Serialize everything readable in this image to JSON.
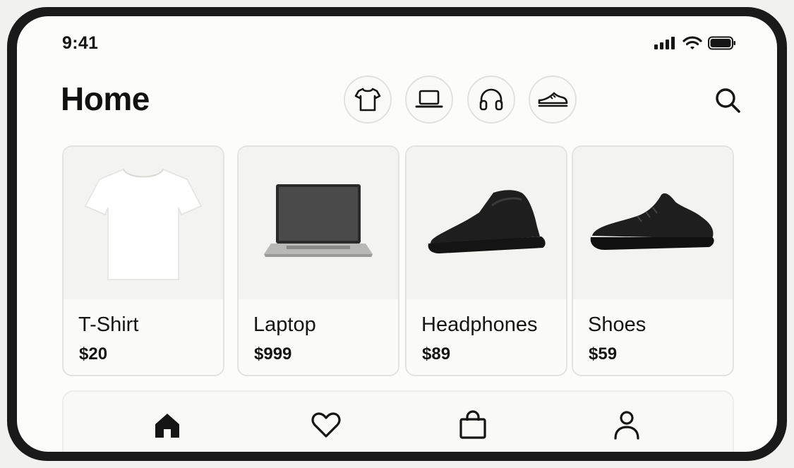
{
  "status_bar": {
    "time": "9:41"
  },
  "header": {
    "title": "Home"
  },
  "categories": [
    {
      "icon": "tshirt-icon"
    },
    {
      "icon": "laptop-icon"
    },
    {
      "icon": "headphones-icon"
    },
    {
      "icon": "sneaker-icon"
    }
  ],
  "search": {
    "icon": "search-icon"
  },
  "products": [
    {
      "name": "T-Shirt",
      "price": "$20"
    },
    {
      "name": "Laptop",
      "price": "$999"
    },
    {
      "name": "Headphones",
      "price": "$89"
    },
    {
      "name": "Shoes",
      "price": "$59"
    }
  ],
  "bottom_nav": [
    {
      "icon": "home-icon",
      "active": true
    },
    {
      "icon": "heart-icon",
      "active": false
    },
    {
      "icon": "bag-icon",
      "active": false
    },
    {
      "icon": "profile-icon",
      "active": false
    }
  ],
  "colors": {
    "background": "#fcfcfa",
    "text": "#151515",
    "frame": "#1a1a1a",
    "border": "#e3e3df"
  }
}
